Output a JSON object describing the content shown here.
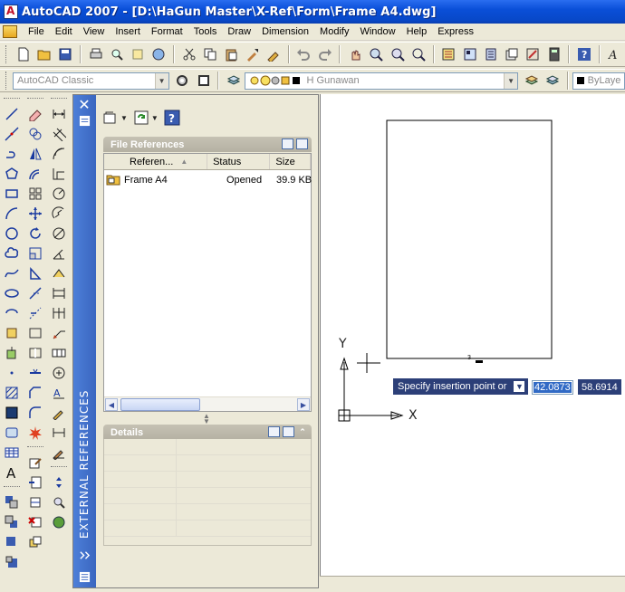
{
  "window": {
    "title": "AutoCAD 2007 - [D:\\HaGun Master\\X-Ref\\Form\\Frame A4.dwg]"
  },
  "menu": [
    "File",
    "Edit",
    "View",
    "Insert",
    "Format",
    "Tools",
    "Draw",
    "Dimension",
    "Modify",
    "Window",
    "Help",
    "Express"
  ],
  "toolbar2": {
    "workspace": "AutoCAD Classic",
    "layer": "H Gunawan",
    "color": "ByLaye"
  },
  "palette": {
    "title": "EXTERNAL REFERENCES",
    "file_references": {
      "header": "File References",
      "columns": [
        "Referen...",
        "Status",
        "Size"
      ],
      "rows": [
        {
          "name": "Frame A4",
          "status": "Opened",
          "size": "39.9 KB"
        }
      ]
    },
    "details": {
      "header": "Details"
    }
  },
  "canvas": {
    "prompt": "Specify insertion point or",
    "coord_x": "42.0873",
    "coord_y": "58.6914",
    "ucs_x": "X",
    "ucs_y": "Y",
    "small_mark": "3"
  },
  "colors": {
    "titlebar": "#0a4fd8",
    "palette_strip": "#3f6fcc",
    "tooltip": "#2c3f78"
  }
}
